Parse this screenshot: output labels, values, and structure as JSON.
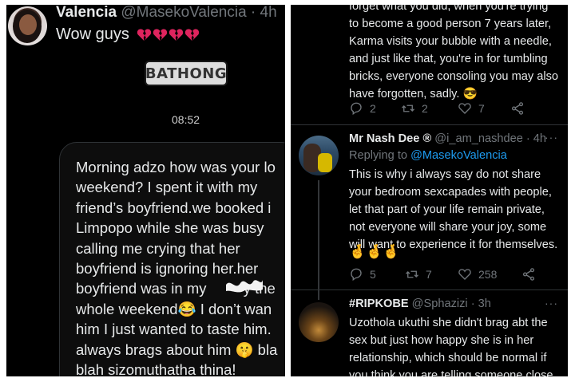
{
  "left": {
    "tweet": {
      "name": "Valencia",
      "handle": "@MasekoValencia · 4h",
      "text": "Wow guys",
      "emoji_count": 4
    },
    "sticker_text": "BATHONG",
    "chat_time": "08:52",
    "chat_message": "Morning adzo how was your lo\nweekend? I spent it with my\nfriend’s boyfriend.we booked i\nLimpopo while she was busy\ncalling me crying that her\nboyfriend is ignoring her.her\nboyfriend was in my         y the\nwhole weekend😂 I don’t wan\nhim I just wanted to taste him.\nalways brags about him 🤫 bla\nblah sizomuthatha thina!"
  },
  "right": {
    "tweet1": {
      "text": "forget what you did, when you're trying\nto become a good person 7 years later,\nKarma visits your bubble with a needle,\nand just like that, you're in for tumbling\nbricks, everyone consoling you may also\nhave forgotten, sadly. 😎",
      "replies": "2",
      "retweets": "2",
      "likes": "7"
    },
    "nash": {
      "name": "Mr Nash Dee ®",
      "handle": "@i_am_nashdee · 4h",
      "more": "···",
      "reply_prefix": "Replying to",
      "reply_mention": "@MasekoValencia",
      "text": "This is why i always say do not share\nyour bedroom sexcapades with people,\nlet that part of your life remain private,\nnot everyone will share your joy, some\nwill want to experience it for themselves.",
      "emojis": "🤞🤞🤞",
      "replies": "5",
      "retweets": "7",
      "likes": "258"
    },
    "ripkobe": {
      "name": "#RIPKOBE",
      "handle": "@Sphazizi · 3h",
      "more": "···",
      "text": "Uzothola ukuthi she didn't brag abt the\nsex but just how happy she is in her\nrelationship, which should be normal if\nyou think you are telling someone close"
    }
  },
  "colors": {
    "background": "#000000",
    "text": "#e7e9ea",
    "muted": "#71767b",
    "link": "#1d9bf0",
    "heart": "#e0245e"
  },
  "icons": [
    "broken-heart-icon",
    "reply-icon",
    "retweet-icon",
    "like-icon",
    "share-icon",
    "more-icon"
  ]
}
